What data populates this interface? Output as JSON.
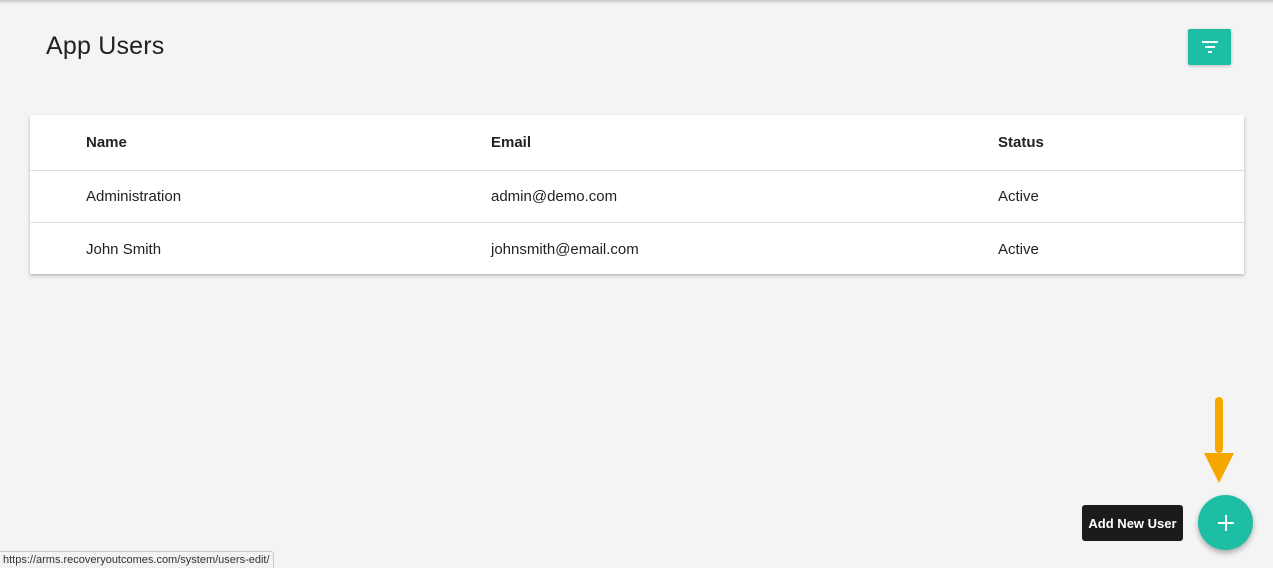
{
  "page": {
    "title": "App Users"
  },
  "filter_button": {
    "icon": "filter-icon"
  },
  "table": {
    "columns": [
      "Name",
      "Email",
      "Status"
    ],
    "rows": [
      {
        "name": "Administration",
        "email": "admin@demo.com",
        "status": "Active"
      },
      {
        "name": "John Smith",
        "email": "johnsmith@email.com",
        "status": "Active"
      }
    ]
  },
  "add_user": {
    "tooltip": "Add New User",
    "icon": "plus-icon"
  },
  "annotation": {
    "icon": "arrow-down-icon",
    "color": "#f5a700"
  },
  "status_bar": {
    "url": "https://arms.recoveryoutcomes.com/system/users-edit/"
  },
  "colors": {
    "accent": "#1ebea5",
    "background": "#f4f4f4",
    "tooltip_bg": "#1b1b1b"
  }
}
